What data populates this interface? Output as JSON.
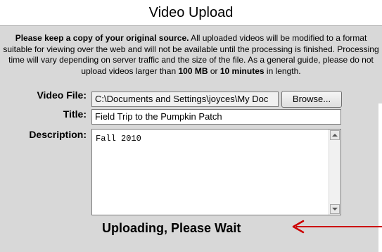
{
  "page": {
    "title": "Video Upload"
  },
  "notice": {
    "part1_bold": "Please keep a copy of your original source.",
    "part2": " All uploaded videos will be modified to a format suitable for viewing over the web and will not be available until the processing is finished. Processing time will vary depending on server traffic and the size of the file. As a general guide, please do not upload videos larger than ",
    "limit_size": "100 MB",
    "part3": " or ",
    "limit_time": "10 minutes",
    "part4": " in length."
  },
  "form": {
    "video_file_label": "Video File:",
    "video_file_value": "C:\\Documents and Settings\\joyces\\My Doc",
    "browse_label": "Browse...",
    "title_label": "Title:",
    "title_value": "Field Trip to the Pumpkin Patch",
    "description_label": "Description:",
    "description_value": "Fall 2010"
  },
  "status": {
    "text": "Uploading, Please Wait",
    "arrow_color": "#cc0000"
  },
  "icons": {
    "scroll_up": "chevron-up-icon",
    "scroll_down": "chevron-down-icon",
    "annotation_arrow": "arrow-left-icon"
  }
}
